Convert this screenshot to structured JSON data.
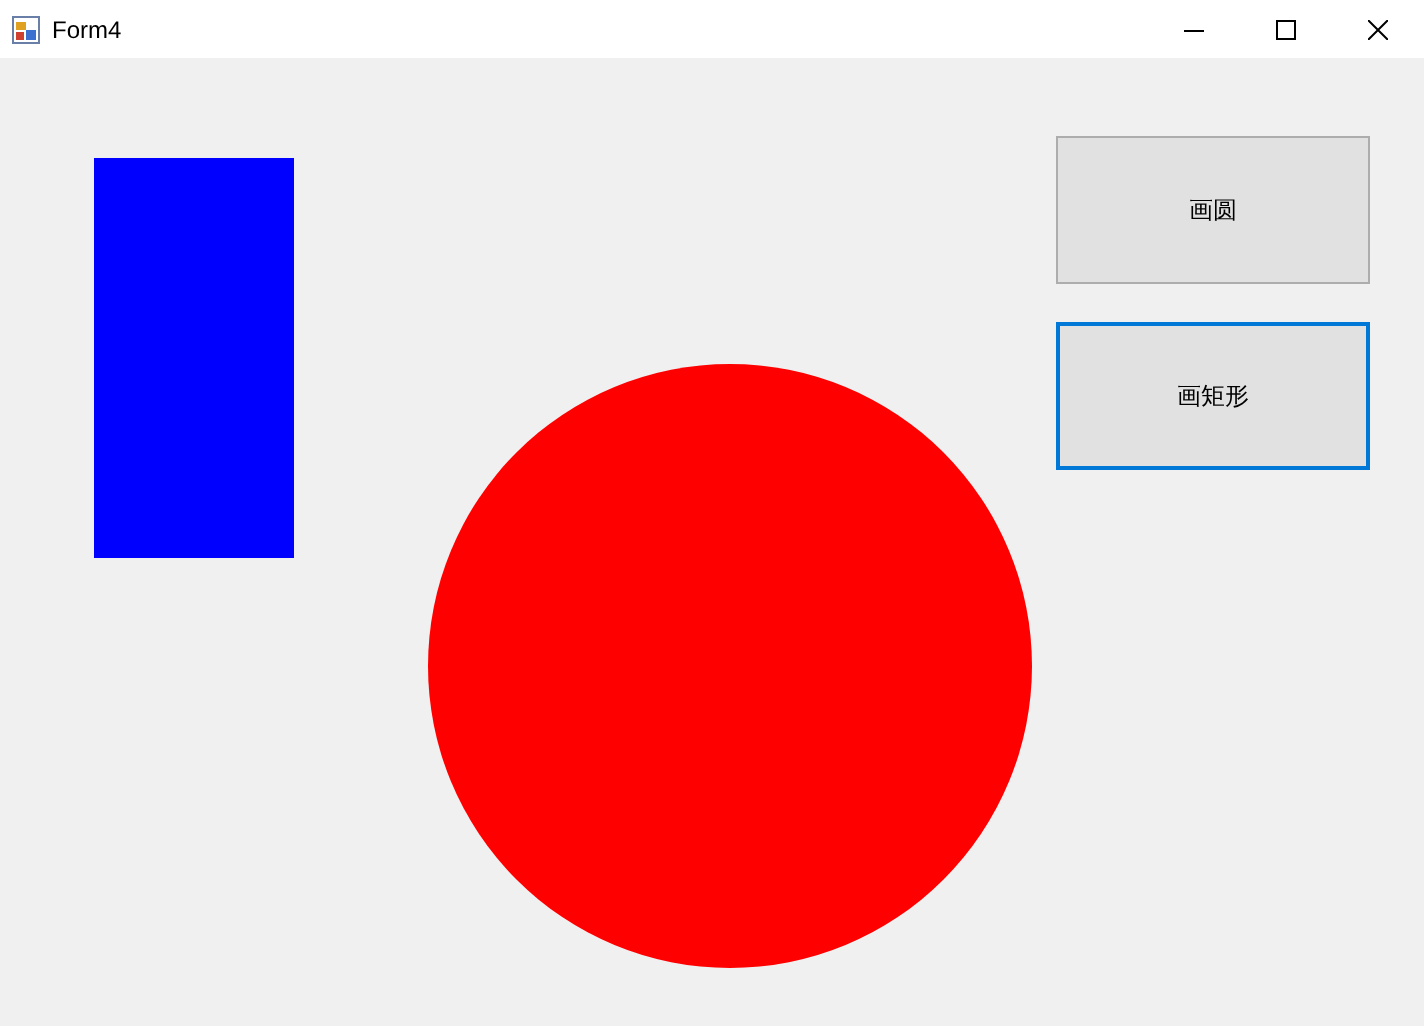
{
  "window": {
    "title": "Form4"
  },
  "buttons": [
    {
      "label": "画圆",
      "focused": false
    },
    {
      "label": "画矩形",
      "focused": true
    }
  ]
}
